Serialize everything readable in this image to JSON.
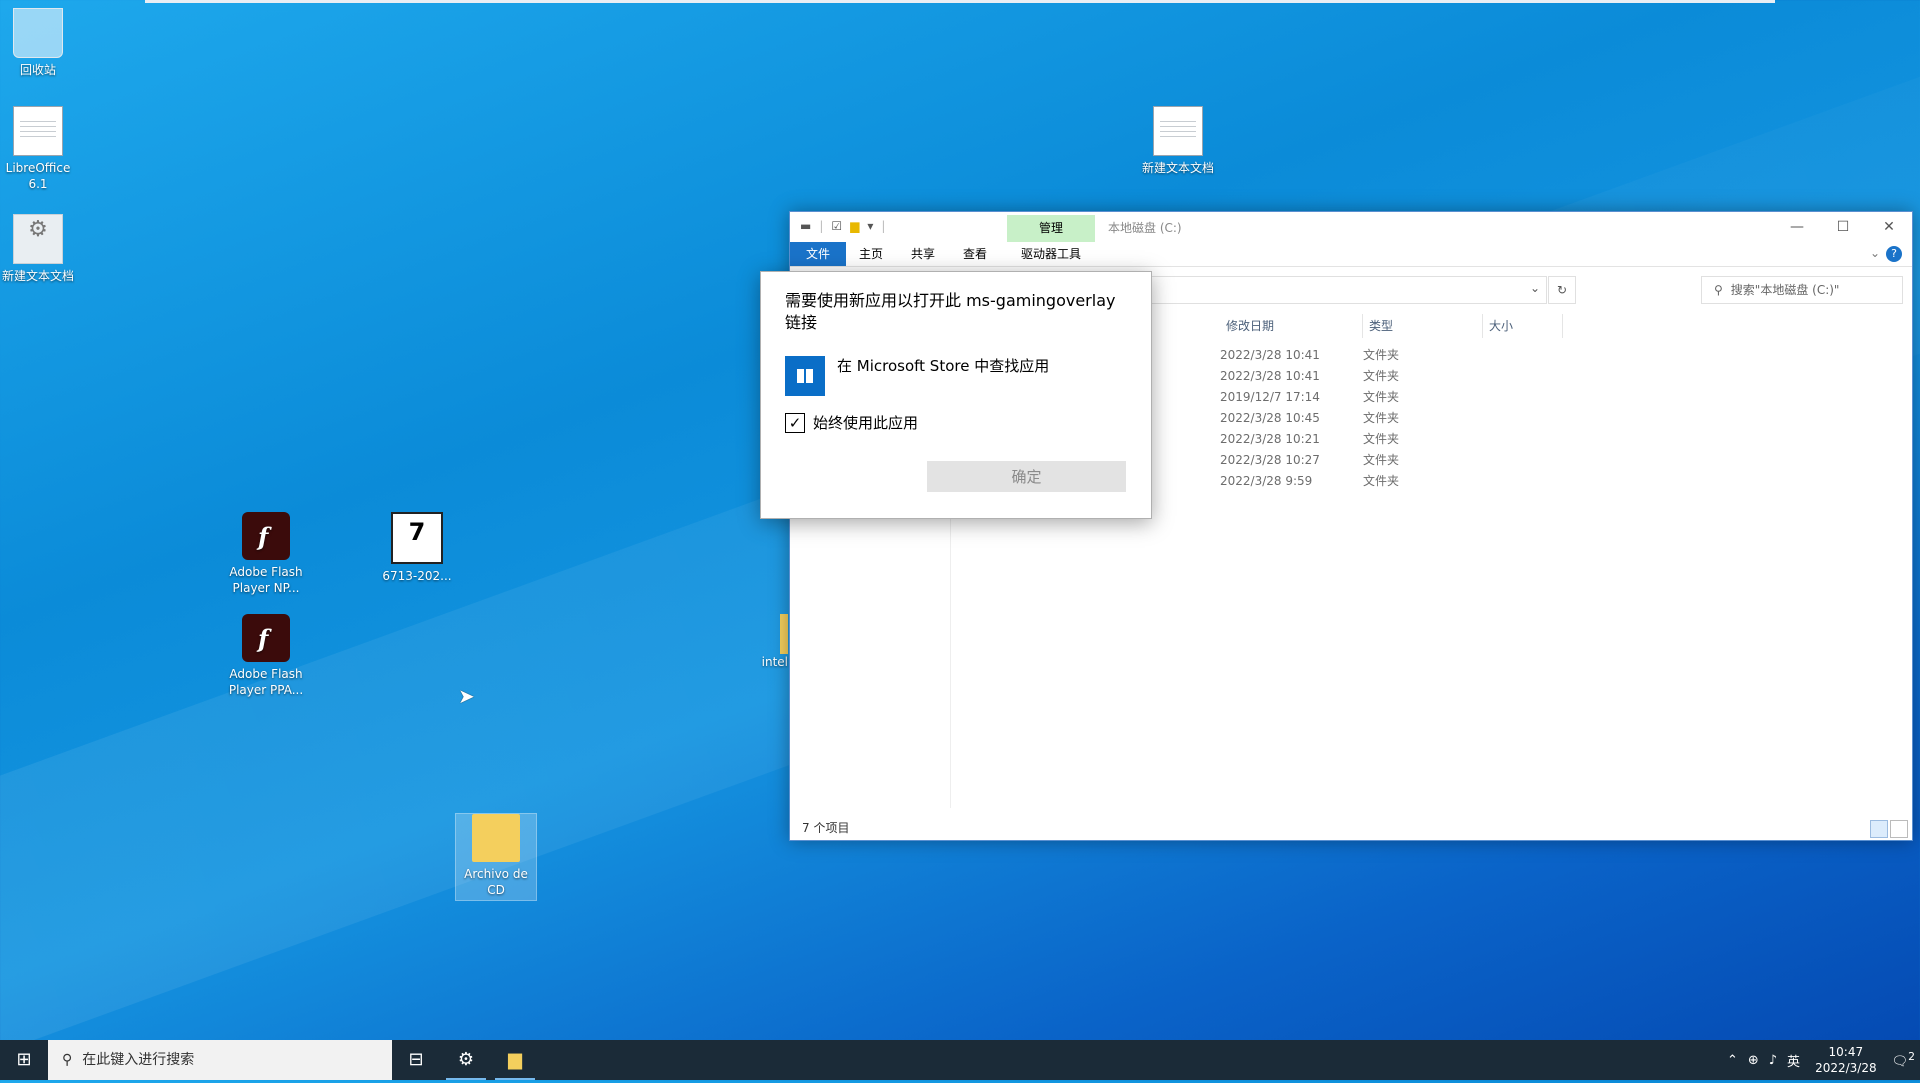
{
  "desktop": {
    "icons": [
      {
        "label": "回收站",
        "icon": "recycle-bin-icon"
      },
      {
        "label": "LibreOffice 6.1",
        "icon": "libreoffice-icon"
      },
      {
        "label": "新建文本文档",
        "icon": "settings-file-icon"
      },
      {
        "label": "新建文本文档",
        "icon": "text-document-icon"
      },
      {
        "label": "Adobe Flash Player NP...",
        "icon": "flash-icon"
      },
      {
        "label": "6713-202...",
        "icon": "7zip-icon"
      },
      {
        "label": "Adobe Flash Player PPA...",
        "icon": "flash-icon"
      },
      {
        "label": "Archivo de CD",
        "icon": "folder-icon"
      },
      {
        "label": "intel",
        "icon": "folder-icon"
      }
    ]
  },
  "explorer": {
    "title": "本地磁盘 (C:)",
    "manage_tab": "管理",
    "tabs": [
      "文件",
      "主页",
      "共享",
      "查看",
      "驱动器工具"
    ],
    "search_placeholder": "搜索\"本地磁盘 (C:)\"",
    "columns": [
      "修改日期",
      "类型",
      "大小"
    ],
    "rows": [
      {
        "date": "2022/3/28 10:41",
        "type": "文件夹"
      },
      {
        "date": "2022/3/28 10:41",
        "type": "文件夹"
      },
      {
        "date": "2019/12/7 17:14",
        "type": "文件夹"
      },
      {
        "date": "2022/3/28 10:45",
        "type": "文件夹"
      },
      {
        "date": "2022/3/28 10:21",
        "type": "文件夹"
      },
      {
        "date": "2022/3/28 10:27",
        "type": "文件夹"
      },
      {
        "date": "2022/3/28 9:59",
        "type": "文件夹"
      }
    ],
    "status": "7 个项目"
  },
  "dialog": {
    "title": "需要使用新应用以打开此 ms-gamingoverlay 链接",
    "store_option": "在 Microsoft Store 中查找应用",
    "always_use": "始终使用此应用",
    "always_checked": true,
    "ok_label": "确定"
  },
  "taskbar": {
    "search_placeholder": "在此键入进行搜索",
    "ime": "英",
    "time": "10:47",
    "date": "2022/3/28",
    "notifications": "2"
  },
  "colors": {
    "accent": "#1a73c9",
    "taskbar": "#1b2b38",
    "manage_tab": "#c8f0c8"
  }
}
